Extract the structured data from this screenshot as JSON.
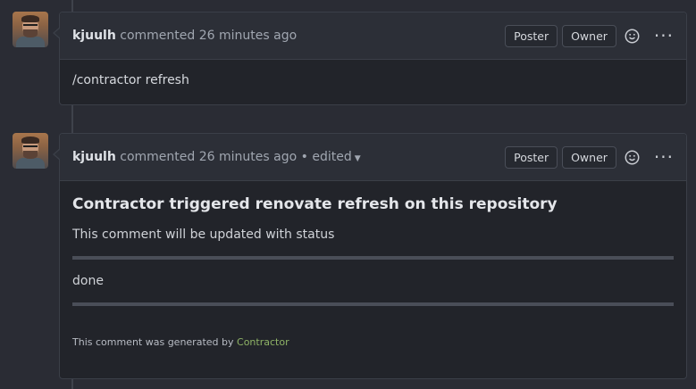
{
  "comments": [
    {
      "author": "kjuulh",
      "action": "commented",
      "time": "26 minutes ago",
      "badges": [
        "Poster",
        "Owner"
      ],
      "body": "/contractor refresh"
    },
    {
      "author": "kjuulh",
      "action": "commented",
      "time": "26 minutes ago",
      "edited_sep": "•",
      "edited": "edited",
      "badges": [
        "Poster",
        "Owner"
      ],
      "heading": "Contractor triggered renovate refresh on this repository",
      "status_line": "This comment will be updated with status",
      "status": "done",
      "footer_text": "This comment was generated by",
      "footer_link": "Contractor"
    }
  ],
  "icons": {
    "reaction": "smiley-icon",
    "menu": "more-horizontal-icon",
    "dropdown": "caret-down-icon",
    "avatar": "user-avatar"
  },
  "colors": {
    "background": "#2a2c34",
    "card": "#22242a",
    "header": "#2c2f37",
    "link": "#8fb366"
  }
}
